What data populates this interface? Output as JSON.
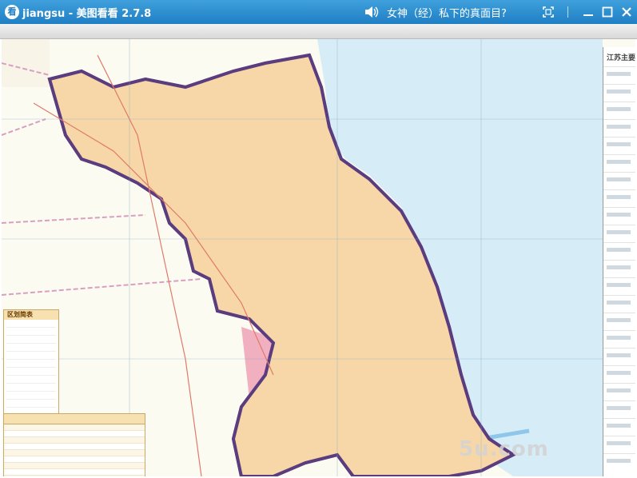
{
  "window": {
    "title": "jiangsu - 美图看看 2.7.8",
    "app_icon_glyph": "看",
    "ad_text": "女神（经）私下的真面目?",
    "icons": [
      "speaker-icon",
      "fullscreen-icon",
      "minimize-icon",
      "maximize-icon",
      "close-icon"
    ],
    "titlebar_color": "#2a8fd2"
  },
  "map": {
    "panel_title": "江苏主要",
    "legend_title": "区划简表",
    "watermark": "5u.com",
    "province_border_color": "#5b3c7e",
    "sea_color": "#d6ecf7"
  }
}
